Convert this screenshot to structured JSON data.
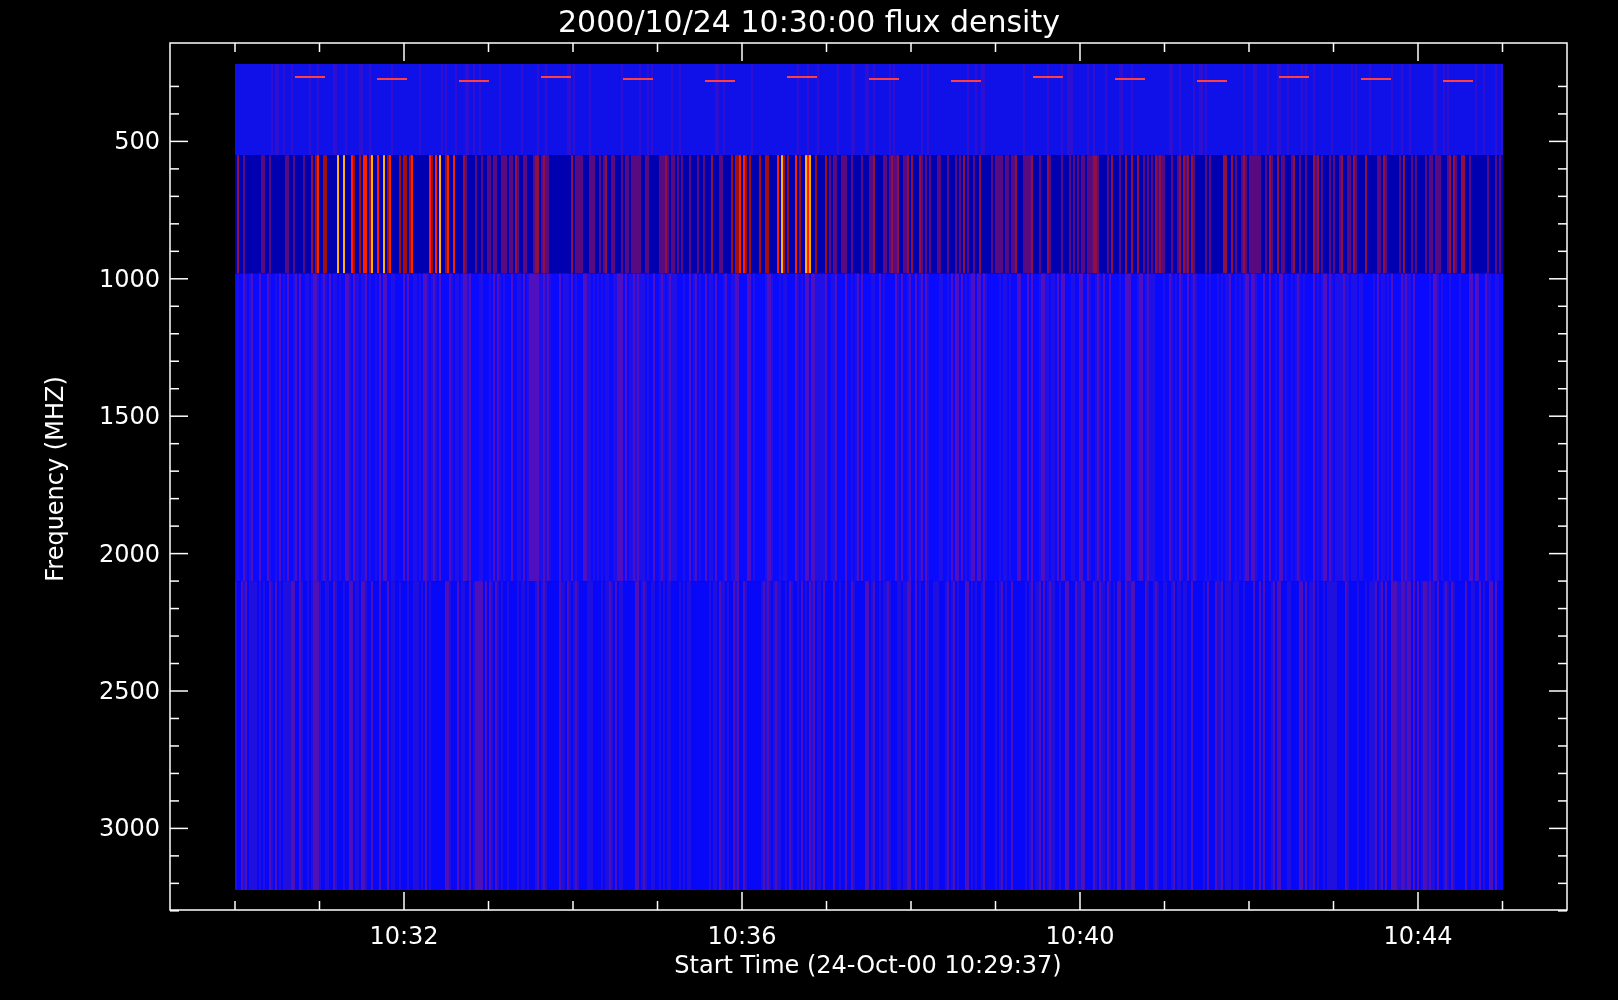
{
  "plot": {
    "title": "2000/10/24 10:30:00 flux density",
    "xlabel": "Start Time (24-Oct-00 10:29:37)",
    "ylabel": "Frequency (MHZ)",
    "x_tick_labels": [
      "10:32",
      "10:36",
      "10:40",
      "10:44"
    ],
    "y_tick_labels": [
      "500",
      "1000",
      "1500",
      "2000",
      "2500",
      "3000"
    ]
  }
}
